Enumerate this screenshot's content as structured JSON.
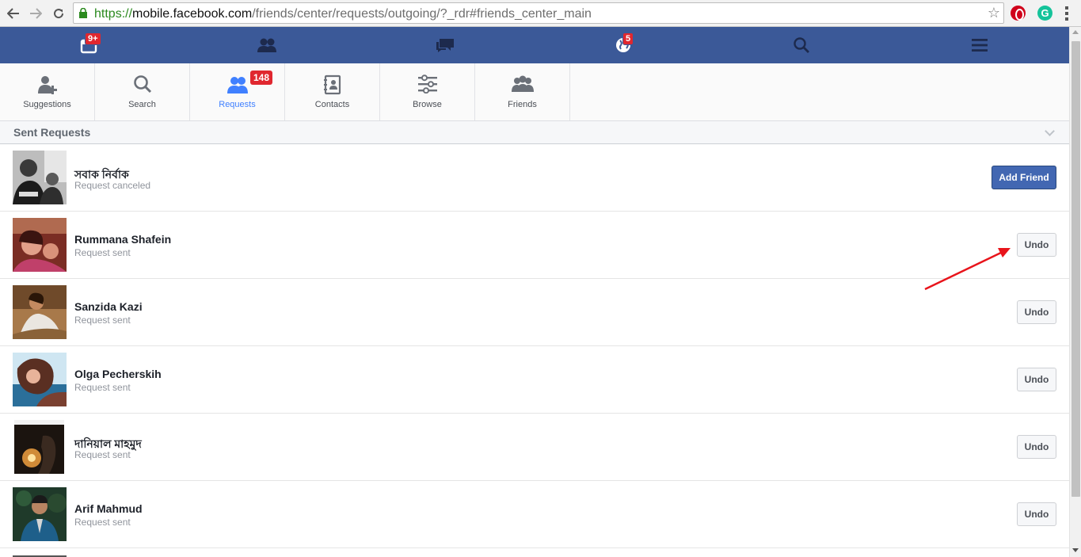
{
  "browser": {
    "url_scheme": "https://",
    "url_host": "mobile.facebook.com",
    "url_path": "/friends/center/requests/outgoing/?_rdr#friends_center_main",
    "extension_g": "G"
  },
  "topbar": {
    "notifications_badge": "9+",
    "globe_badge": "5"
  },
  "tabs": [
    {
      "label": "Suggestions",
      "icon": "add-person-icon"
    },
    {
      "label": "Search",
      "icon": "search-icon"
    },
    {
      "label": "Requests",
      "icon": "people-icon",
      "badge": "148",
      "active": true
    },
    {
      "label": "Contacts",
      "icon": "contacts-book-icon"
    },
    {
      "label": "Browse",
      "icon": "sliders-icon"
    },
    {
      "label": "Friends",
      "icon": "friends-icon"
    }
  ],
  "section": {
    "title": "Sent Requests"
  },
  "requests": [
    {
      "name": "সবাক নির্বাক",
      "status": "Request canceled",
      "action": "Add Friend"
    },
    {
      "name": "Rummana Shafein",
      "status": "Request sent",
      "action": "Undo"
    },
    {
      "name": "Sanzida Kazi",
      "status": "Request sent",
      "action": "Undo"
    },
    {
      "name": "Olga Pecherskih",
      "status": "Request sent",
      "action": "Undo"
    },
    {
      "name": "দানিয়াল মাহমুদ",
      "status": "Request sent",
      "action": "Undo"
    },
    {
      "name": "Arif Mahmud",
      "status": "Request sent",
      "action": "Undo"
    }
  ],
  "colors": {
    "facebook_blue": "#3b5998",
    "button_blue": "#4267b2",
    "badge_red": "#e0272f",
    "annotation_arrow": "#e8141b"
  }
}
